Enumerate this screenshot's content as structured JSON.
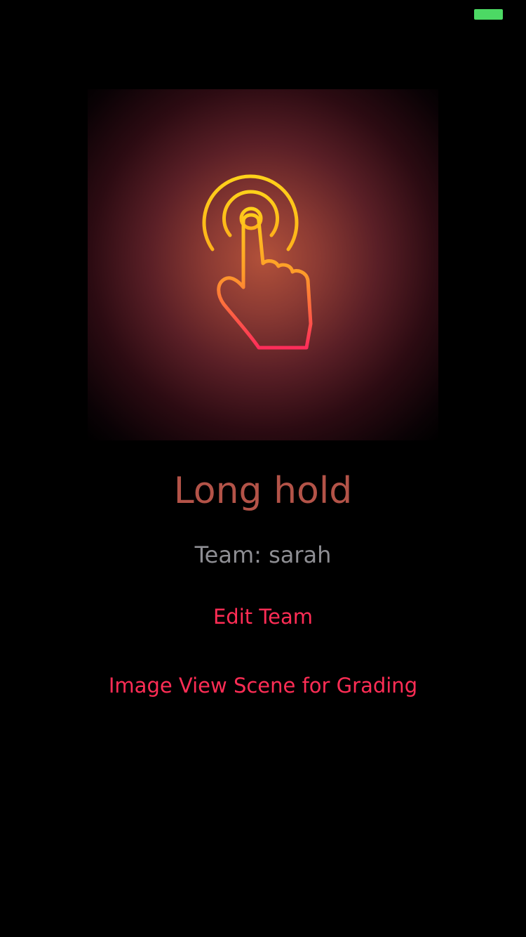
{
  "status_bar": {
    "battery_color": "#4cd964"
  },
  "hero": {
    "icon": "tap-hold-hand-icon"
  },
  "main": {
    "title": "Long hold",
    "team_label": "Team: sarah",
    "edit_team_label": "Edit Team",
    "grading_label": "Image View Scene for Grading"
  },
  "colors": {
    "title": "#b35348",
    "secondary_text": "#8e8e93",
    "accent": "#ff2d55"
  }
}
